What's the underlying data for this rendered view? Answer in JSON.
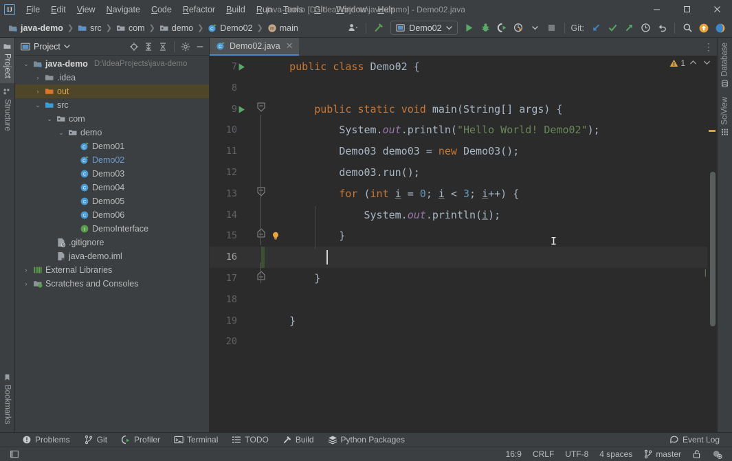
{
  "window": {
    "title": "java-demo [D:\\IdeaProjects\\java-demo] - Demo02.java",
    "logo": "ij-logo",
    "minimize": "—",
    "maximize": "☐",
    "close": "✕"
  },
  "menu": [
    {
      "label": "File",
      "mnemonic": "F",
      "rest": "ile"
    },
    {
      "label": "Edit",
      "mnemonic": "E",
      "rest": "dit"
    },
    {
      "label": "View",
      "mnemonic": "V",
      "rest": "iew"
    },
    {
      "label": "Navigate",
      "mnemonic": "N",
      "rest": "avigate"
    },
    {
      "label": "Code",
      "mnemonic": "C",
      "rest": "ode"
    },
    {
      "label": "Refactor",
      "mnemonic": "R",
      "rest": "efactor"
    },
    {
      "label": "Build",
      "mnemonic": "B",
      "rest": "uild"
    },
    {
      "label": "Run",
      "mnemonic": "R",
      "rest": "un"
    },
    {
      "label": "Tools",
      "mnemonic": "T",
      "rest": "ools"
    },
    {
      "label": "Git",
      "mnemonic": "G",
      "rest": "it"
    },
    {
      "label": "Window",
      "mnemonic": "W",
      "rest": "indow"
    },
    {
      "label": "Help",
      "mnemonic": "H",
      "rest": "elp"
    }
  ],
  "breadcrumbs": [
    {
      "label": "java-demo",
      "icon": "project-icon",
      "bold": true
    },
    {
      "label": "src",
      "icon": "folder-icon",
      "bold": false
    },
    {
      "label": "com",
      "icon": "package-icon",
      "bold": false
    },
    {
      "label": "demo",
      "icon": "package-icon",
      "bold": false
    },
    {
      "label": "Demo02",
      "icon": "class-icon",
      "bold": false
    },
    {
      "label": "main",
      "icon": "method-icon",
      "bold": false
    }
  ],
  "toolbar": {
    "run_config": "Demo02",
    "run_config_icon": "run-config-icon",
    "git_label": "Git:",
    "buttons": [
      {
        "name": "user-settings-button",
        "icon": "person-dropdown-icon"
      },
      {
        "name": "build-project-button",
        "icon": "hammer-icon"
      },
      {
        "name": "run-button",
        "icon": "run-triangle-icon"
      },
      {
        "name": "debug-button",
        "icon": "debug-bug-icon"
      },
      {
        "name": "run-with-coverage-button",
        "icon": "coverage-icon"
      },
      {
        "name": "profile-button",
        "icon": "profiler-clock-icon"
      },
      {
        "name": "stop-button",
        "icon": "stop-square-icon"
      },
      {
        "name": "git-update-button",
        "icon": "arrow-down-left-icon"
      },
      {
        "name": "git-commit-button",
        "icon": "checkmark-icon"
      },
      {
        "name": "git-push-button",
        "icon": "arrow-up-right-icon"
      },
      {
        "name": "git-history-button",
        "icon": "clock-icon"
      },
      {
        "name": "git-rollback-button",
        "icon": "undo-arrow-icon"
      },
      {
        "name": "search-everywhere-button",
        "icon": "search-icon"
      },
      {
        "name": "notifications-button",
        "icon": "orange-circle-arrow-icon"
      },
      {
        "name": "ide-assistant-button",
        "icon": "blue-sphere-icon"
      }
    ]
  },
  "left_strip": {
    "top": [
      {
        "label": "Project",
        "icon": "project-window-icon",
        "active": true
      },
      {
        "label": "Structure",
        "icon": "structure-icon",
        "active": false
      }
    ],
    "bottom": [
      {
        "label": "Bookmarks",
        "icon": "bookmark-icon",
        "active": false
      }
    ]
  },
  "right_strip": {
    "items": [
      {
        "label": "Database",
        "icon": "database-icon"
      },
      {
        "label": "SciView",
        "icon": "sciview-grid-icon"
      }
    ]
  },
  "project_panel": {
    "title": "Project",
    "dropdown": "▼",
    "header_icons": [
      {
        "name": "select-opened-file-icon",
        "glyph": "⊕"
      },
      {
        "name": "expand-all-icon",
        "glyph": "⇥"
      },
      {
        "name": "collapse-all-icon",
        "glyph": "⇤"
      },
      {
        "name": "project-settings-gear-icon",
        "glyph": "⚙"
      },
      {
        "name": "hide-panel-icon",
        "glyph": "—"
      }
    ],
    "tree": [
      {
        "indent": 0,
        "twist": "⌄",
        "icon": "module-icon",
        "label": "java-demo",
        "sub": "D:\\IdeaProjects\\java-demo",
        "bold": true,
        "color": "#d6d6d6",
        "selected": false
      },
      {
        "indent": 1,
        "twist": "›",
        "icon": "folder-icon",
        "label": ".idea",
        "sub": "",
        "bold": false,
        "color": "#bbbbbb",
        "selected": false
      },
      {
        "indent": 1,
        "twist": "›",
        "icon": "out-folder-icon",
        "label": "out",
        "sub": "",
        "bold": false,
        "color": "#d8a14a",
        "selected": true
      },
      {
        "indent": 1,
        "twist": "⌄",
        "icon": "source-root-icon",
        "label": "src",
        "sub": "",
        "bold": false,
        "color": "#bbbbbb",
        "selected": false
      },
      {
        "indent": 2,
        "twist": "⌄",
        "icon": "package-icon",
        "label": "com",
        "sub": "",
        "bold": false,
        "color": "#bbbbbb",
        "selected": false
      },
      {
        "indent": 3,
        "twist": "⌄",
        "icon": "package-icon",
        "label": "demo",
        "sub": "",
        "bold": false,
        "color": "#bbbbbb",
        "selected": false
      },
      {
        "indent": 4,
        "twist": "",
        "icon": "runnable-class-icon",
        "label": "Demo01",
        "sub": "",
        "bold": false,
        "color": "#bbbbbb",
        "selected": false
      },
      {
        "indent": 4,
        "twist": "",
        "icon": "runnable-class-icon",
        "label": "Demo02",
        "sub": "",
        "bold": false,
        "color": "#6c9cd2",
        "selected": false
      },
      {
        "indent": 4,
        "twist": "",
        "icon": "class-icon",
        "label": "Demo03",
        "sub": "",
        "bold": false,
        "color": "#bbbbbb",
        "selected": false
      },
      {
        "indent": 4,
        "twist": "",
        "icon": "class-icon",
        "label": "Demo04",
        "sub": "",
        "bold": false,
        "color": "#bbbbbb",
        "selected": false
      },
      {
        "indent": 4,
        "twist": "",
        "icon": "class-icon",
        "label": "Demo05",
        "sub": "",
        "bold": false,
        "color": "#bbbbbb",
        "selected": false
      },
      {
        "indent": 4,
        "twist": "",
        "icon": "class-icon",
        "label": "Demo06",
        "sub": "",
        "bold": false,
        "color": "#bbbbbb",
        "selected": false
      },
      {
        "indent": 4,
        "twist": "",
        "icon": "interface-icon",
        "label": "DemoInterface",
        "sub": "",
        "bold": false,
        "color": "#bbbbbb",
        "selected": false
      },
      {
        "indent": 2,
        "twist": "",
        "icon": "gitignore-file-icon",
        "label": ".gitignore",
        "sub": "",
        "bold": false,
        "color": "#bbbbbb",
        "selected": false
      },
      {
        "indent": 2,
        "twist": "",
        "icon": "iml-file-icon",
        "label": "java-demo.iml",
        "sub": "",
        "bold": false,
        "color": "#bbbbbb",
        "selected": false
      },
      {
        "indent": 0,
        "twist": "›",
        "icon": "libraries-icon",
        "label": "External Libraries",
        "sub": "",
        "bold": false,
        "color": "#bbbbbb",
        "selected": false
      },
      {
        "indent": 0,
        "twist": "›",
        "icon": "scratches-icon",
        "label": "Scratches and Consoles",
        "sub": "",
        "bold": false,
        "color": "#bbbbbb",
        "selected": false
      }
    ]
  },
  "editor": {
    "tab": {
      "label": "Demo02.java",
      "icon": "runnable-class-icon",
      "close": "✕"
    },
    "options_icon": "⋮",
    "inspection": {
      "warning_count": "1",
      "warning_icon": "warning-triangle-icon",
      "prev": "⌃",
      "next": "⌄"
    },
    "lines": [
      {
        "num": "7",
        "run": true,
        "fold": "none",
        "bulb": false,
        "current": false,
        "tokens": [
          {
            "t": "    ",
            "c": "pl"
          },
          {
            "t": "public",
            "c": "kw"
          },
          {
            "t": " ",
            "c": "pl"
          },
          {
            "t": "class",
            "c": "kw"
          },
          {
            "t": " Demo02 {",
            "c": "pl"
          }
        ]
      },
      {
        "num": "8",
        "run": false,
        "fold": "none",
        "bulb": false,
        "current": false,
        "tokens": []
      },
      {
        "num": "9",
        "run": true,
        "fold": "start",
        "bulb": false,
        "current": false,
        "tokens": [
          {
            "t": "        ",
            "c": "pl"
          },
          {
            "t": "public",
            "c": "kw"
          },
          {
            "t": " ",
            "c": "pl"
          },
          {
            "t": "static",
            "c": "kw"
          },
          {
            "t": " ",
            "c": "pl"
          },
          {
            "t": "void",
            "c": "kw"
          },
          {
            "t": " main(String[] args) {",
            "c": "pl"
          }
        ]
      },
      {
        "num": "10",
        "run": false,
        "fold": "none",
        "bulb": false,
        "current": false,
        "tokens": [
          {
            "t": "            System.",
            "c": "pl"
          },
          {
            "t": "out",
            "c": "fld"
          },
          {
            "t": ".println(",
            "c": "pl"
          },
          {
            "t": "\"Hello World! Demo02\"",
            "c": "st"
          },
          {
            "t": ");",
            "c": "pl"
          }
        ]
      },
      {
        "num": "11",
        "run": false,
        "fold": "none",
        "bulb": false,
        "current": false,
        "tokens": [
          {
            "t": "            Demo03 demo03 = ",
            "c": "pl"
          },
          {
            "t": "new",
            "c": "kw"
          },
          {
            "t": " Demo03();",
            "c": "pl"
          }
        ]
      },
      {
        "num": "12",
        "run": false,
        "fold": "none",
        "bulb": false,
        "current": false,
        "tokens": [
          {
            "t": "            demo03.run();",
            "c": "pl"
          }
        ]
      },
      {
        "num": "13",
        "run": false,
        "fold": "start",
        "bulb": false,
        "current": false,
        "tokens": [
          {
            "t": "            ",
            "c": "pl"
          },
          {
            "t": "for",
            "c": "kw"
          },
          {
            "t": " (",
            "c": "pl"
          },
          {
            "t": "int",
            "c": "kw"
          },
          {
            "t": " ",
            "c": "pl"
          },
          {
            "t": "i",
            "c": "us"
          },
          {
            "t": " = ",
            "c": "pl"
          },
          {
            "t": "0",
            "c": "num"
          },
          {
            "t": "; ",
            "c": "pl"
          },
          {
            "t": "i",
            "c": "us"
          },
          {
            "t": " < ",
            "c": "pl"
          },
          {
            "t": "3",
            "c": "num"
          },
          {
            "t": "; ",
            "c": "pl"
          },
          {
            "t": "i",
            "c": "us"
          },
          {
            "t": "++) {",
            "c": "pl"
          }
        ]
      },
      {
        "num": "14",
        "run": false,
        "fold": "none",
        "bulb": false,
        "current": false,
        "tokens": [
          {
            "t": "                System.",
            "c": "pl"
          },
          {
            "t": "out",
            "c": "fld"
          },
          {
            "t": ".println(",
            "c": "pl"
          },
          {
            "t": "i",
            "c": "us"
          },
          {
            "t": ");",
            "c": "pl"
          }
        ]
      },
      {
        "num": "15",
        "run": false,
        "fold": "end",
        "bulb": true,
        "current": false,
        "tokens": [
          {
            "t": "            }",
            "c": "pl"
          }
        ]
      },
      {
        "num": "16",
        "run": false,
        "fold": "none",
        "bulb": false,
        "current": true,
        "tokens": [
          {
            "t": "            ",
            "c": "pl"
          }
        ]
      },
      {
        "num": "17",
        "run": false,
        "fold": "end",
        "bulb": false,
        "current": false,
        "tokens": [
          {
            "t": "        }",
            "c": "pl"
          }
        ]
      },
      {
        "num": "18",
        "run": false,
        "fold": "none",
        "bulb": false,
        "current": false,
        "tokens": []
      },
      {
        "num": "19",
        "run": false,
        "fold": "none",
        "bulb": false,
        "current": false,
        "tokens": [
          {
            "t": "    }",
            "c": "pl"
          }
        ]
      },
      {
        "num": "20",
        "run": false,
        "fold": "none",
        "bulb": false,
        "current": false,
        "tokens": []
      }
    ]
  },
  "bottom_bar": {
    "items": [
      {
        "label": "Problems",
        "icon": "problems-icon"
      },
      {
        "label": "Git",
        "icon": "git-branch-icon"
      },
      {
        "label": "Profiler",
        "icon": "profiler-icon"
      },
      {
        "label": "Terminal",
        "icon": "terminal-icon"
      },
      {
        "label": "TODO",
        "icon": "todo-list-icon"
      },
      {
        "label": "Build",
        "icon": "build-hammer-icon"
      },
      {
        "label": "Python Packages",
        "icon": "packages-icon"
      }
    ],
    "event_log": {
      "label": "Event Log",
      "icon": "event-log-icon"
    }
  },
  "status_bar": {
    "left_icon": "toggle-tool-window-icon",
    "position": "16:9",
    "line_separator": "CRLF",
    "encoding": "UTF-8",
    "indent": "4 spaces",
    "branch": "master",
    "branch_icon": "git-branch-icon",
    "lock_icon": "read-only-lock-icon",
    "inspections_icon": "inspections-level-icon"
  },
  "colors": {
    "accent_blue": "#4a88c7",
    "keyword_orange": "#cc7832",
    "string_green": "#6a8759",
    "number_blue": "#6897bb",
    "field_purple": "#9876aa",
    "warning_amber": "#d9a343",
    "out_folder": "#d8a14a",
    "editor_bg": "#2b2b2b",
    "chrome_bg": "#3c3f41"
  }
}
